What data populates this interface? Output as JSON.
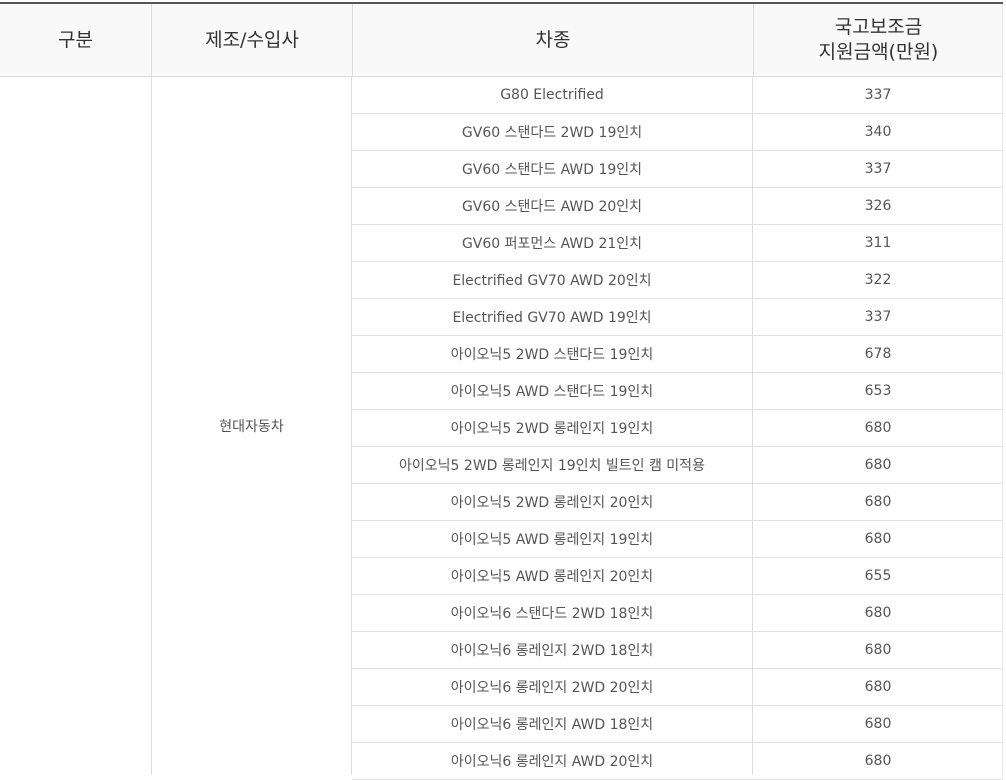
{
  "table": {
    "headers": {
      "category": "구분",
      "maker": "제조/수입사",
      "model": "차종",
      "subsidy_line1": "국고보조금",
      "subsidy_line2": "지원금액(만원)"
    },
    "maker_name": "현대자동차",
    "rows": [
      {
        "model": "G80 Electrified",
        "amount": "337"
      },
      {
        "model": "GV60 스탠다드 2WD 19인치",
        "amount": "340"
      },
      {
        "model": "GV60 스탠다드 AWD 19인치",
        "amount": "337"
      },
      {
        "model": "GV60 스탠다드 AWD 20인치",
        "amount": "326"
      },
      {
        "model": "GV60 퍼포먼스 AWD 21인치",
        "amount": "311"
      },
      {
        "model": "Electrified GV70 AWD 20인치",
        "amount": "322"
      },
      {
        "model": "Electrified GV70 AWD 19인치",
        "amount": "337"
      },
      {
        "model": "아이오닉5 2WD 스탠다드 19인치",
        "amount": "678"
      },
      {
        "model": "아이오닉5 AWD 스탠다드 19인치",
        "amount": "653"
      },
      {
        "model": "아이오닉5 2WD 롱레인지 19인치",
        "amount": "680"
      },
      {
        "model": "아이오닉5 2WD 롱레인지 19인치 빌트인 캠 미적용",
        "amount": "680"
      },
      {
        "model": "아이오닉5 2WD 롱레인지 20인치",
        "amount": "680"
      },
      {
        "model": "아이오닉5 AWD 롱레인지 19인치",
        "amount": "680"
      },
      {
        "model": "아이오닉5 AWD 롱레인지 20인치",
        "amount": "655"
      },
      {
        "model": "아이오닉6 스탠다드 2WD 18인치",
        "amount": "680"
      },
      {
        "model": "아이오닉6 롱레인지 2WD 18인치",
        "amount": "680"
      },
      {
        "model": "아이오닉6 롱레인지 2WD 20인치",
        "amount": "680"
      },
      {
        "model": "아이오닉6 롱레인지 AWD 18인치",
        "amount": "680"
      },
      {
        "model": "아이오닉6 롱레인지 AWD 20인치",
        "amount": "680"
      }
    ]
  }
}
